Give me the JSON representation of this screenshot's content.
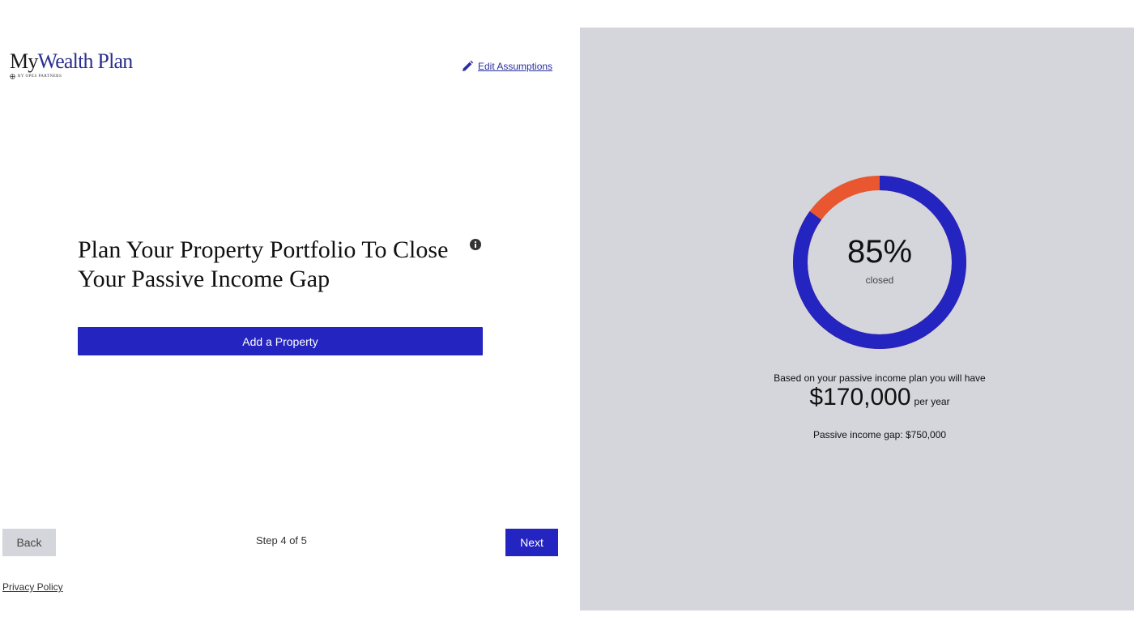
{
  "brand": {
    "name_part1": "My",
    "name_part2": "Wealth Plan",
    "tagline": "BY OPES PARTNERS"
  },
  "header": {
    "edit_label": "Edit Assumptions"
  },
  "main": {
    "title": "Plan Your Property Portfolio To Close Your Passive Income Gap",
    "add_property_label": "Add a Property"
  },
  "footer": {
    "back_label": "Back",
    "step_text": "Step 4 of 5",
    "next_label": "Next",
    "privacy_label": "Privacy Policy"
  },
  "summary": {
    "percent_text": "85%",
    "percent_value": 85,
    "closed_label": "closed",
    "based_text": "Based on your passive income plan you will have",
    "amount": "$170,000",
    "per_year": "per year",
    "gap_text": "Passive income gap: $750,000"
  },
  "colors": {
    "accent": "#2424c0",
    "remaining": "#e8572f",
    "panel_bg": "#d4d6dc"
  },
  "icons": {
    "edit": "pencil-icon",
    "info": "info-icon"
  }
}
